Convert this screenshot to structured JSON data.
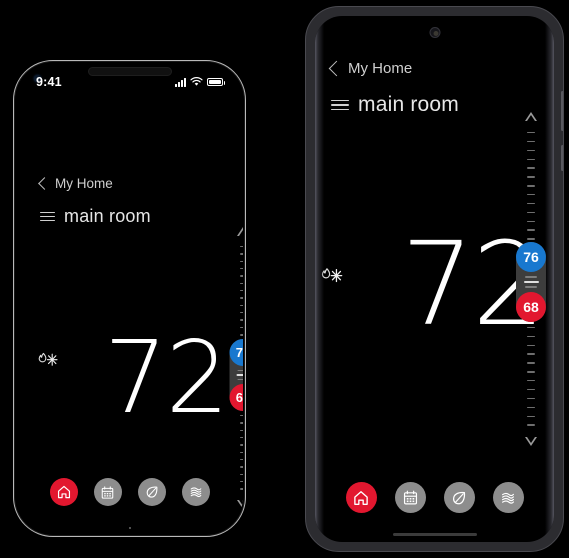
{
  "app": {
    "breadcrumb": "My Home",
    "room_title": "main room",
    "current_temperature": "72",
    "mode_icon": "flame-snowflake-icon",
    "setpoints": {
      "cool_label": "76",
      "heat_label": "68",
      "cool_color": "#1878cf",
      "heat_color": "#e2172f"
    },
    "slider": {
      "increase_icon": "triangle-up-icon",
      "decrease_icon": "triangle-down-icon",
      "tick_count": 34
    },
    "bottom_nav": [
      {
        "id": "home",
        "icon": "home-icon",
        "label": "Home",
        "active": true
      },
      {
        "id": "schedule",
        "icon": "calendar-icon",
        "label": "Schedule",
        "active": false
      },
      {
        "id": "eco",
        "icon": "leaf-icon",
        "label": "Eco",
        "active": false
      },
      {
        "id": "fan",
        "icon": "waves-icon",
        "label": "Fan",
        "active": false
      }
    ],
    "accent_color": "#e2172f",
    "inactive_color": "#8d8d8d"
  },
  "devices": [
    {
      "id": "ios",
      "name": "iphone-mockup",
      "status_bar": {
        "time": "9:41",
        "signal_icon": "cellular-bars-icon",
        "wifi_icon": "wifi-icon",
        "battery_icon": "battery-full-icon"
      },
      "notch": "dynamic-island"
    },
    {
      "id": "android",
      "name": "android-mockup",
      "notch": "punch-hole-camera"
    }
  ]
}
